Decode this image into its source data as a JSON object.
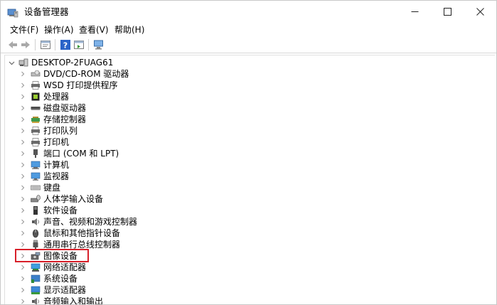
{
  "window": {
    "title": "设备管理器",
    "controls": {
      "minimize": "—",
      "maximize": "☐",
      "close": "✕"
    }
  },
  "menu": [
    {
      "label": "文件(F)"
    },
    {
      "label": "操作(A)"
    },
    {
      "label": "查看(V)"
    },
    {
      "label": "帮助(H)"
    }
  ],
  "toolbar": {
    "buttons": [
      "back-arrow-icon",
      "forward-arrow-icon",
      "properties-icon",
      "help-icon",
      "update-driver-icon",
      "scan-hardware-icon"
    ]
  },
  "tree": {
    "root": "DESKTOP-2FUAG61",
    "items": [
      {
        "label": "DVD/CD-ROM 驱动器",
        "icon": "dvd-drive-icon"
      },
      {
        "label": "WSD 打印提供程序",
        "icon": "printer-icon"
      },
      {
        "label": "处理器",
        "icon": "processor-icon"
      },
      {
        "label": "磁盘驱动器",
        "icon": "disk-drive-icon"
      },
      {
        "label": "存储控制器",
        "icon": "storage-controller-icon"
      },
      {
        "label": "打印队列",
        "icon": "print-queue-icon"
      },
      {
        "label": "打印机",
        "icon": "printer-icon"
      },
      {
        "label": "端口 (COM 和 LPT)",
        "icon": "port-icon"
      },
      {
        "label": "计算机",
        "icon": "computer-icon"
      },
      {
        "label": "监视器",
        "icon": "monitor-icon"
      },
      {
        "label": "键盘",
        "icon": "keyboard-icon"
      },
      {
        "label": "人体学输入设备",
        "icon": "hid-icon"
      },
      {
        "label": "软件设备",
        "icon": "software-device-icon"
      },
      {
        "label": "声音、视频和游戏控制器",
        "icon": "sound-icon"
      },
      {
        "label": "鼠标和其他指针设备",
        "icon": "mouse-icon"
      },
      {
        "label": "通用串行总线控制器",
        "icon": "usb-icon"
      },
      {
        "label": "图像设备",
        "icon": "camera-icon"
      },
      {
        "label": "网络适配器",
        "icon": "network-adapter-icon"
      },
      {
        "label": "系统设备",
        "icon": "system-device-icon"
      },
      {
        "label": "显示适配器",
        "icon": "display-adapter-icon"
      },
      {
        "label": "音频输入和输出",
        "icon": "audio-io-icon"
      }
    ]
  },
  "colors": {
    "highlight": "#d8202a",
    "accent": "#2a7bd6"
  }
}
